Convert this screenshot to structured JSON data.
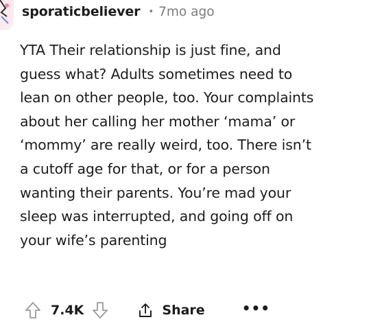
{
  "comment": {
    "author": "sporaticbeliever",
    "separator": "•",
    "timestamp": "7mo ago",
    "body_lines": [
      "YTA Their relationship is just fine, and",
      "guess what? Adults sometimes need to",
      "lean on other people, too. Your complaints",
      "about her calling her mother ‘mama’ or",
      "‘mommy’ are really weird, too. There isn’t",
      "a cutoff age for that, or for a person",
      "wanting their parents. You’re mad your",
      "sleep was interrupted, and going off on",
      "your wife’s parenting"
    ]
  },
  "actions": {
    "upvote_icon": "upvote-arrow-icon",
    "vote_count": "7.4K",
    "downvote_icon": "downvote-arrow-icon",
    "share_icon": "share-icon",
    "share_label": "Share",
    "more_icon": "more-options-icon",
    "more_label": "•••"
  },
  "colors": {
    "text": "#1c1c1c",
    "meta": "#7c7c7c",
    "icon_stroke": "#9a9a9a",
    "avatar_bg": "#fbeaf0"
  }
}
